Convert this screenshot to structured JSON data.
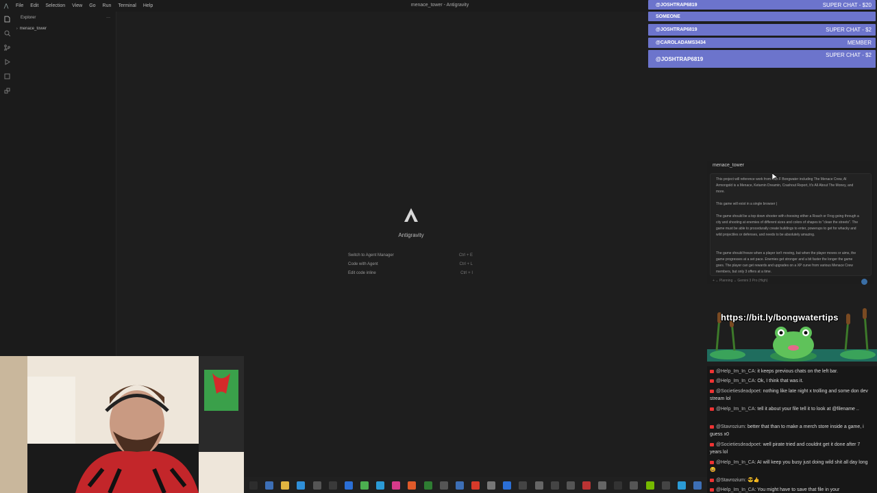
{
  "menubar": {
    "items": [
      "File",
      "Edit",
      "Selection",
      "View",
      "Go",
      "Run",
      "Terminal",
      "Help"
    ],
    "title": "menace_tower - Antigravity"
  },
  "sidebar": {
    "header": "Explorer",
    "more": "···",
    "folder": "menace_tower"
  },
  "welcome": {
    "app_name": "Antigravity",
    "shortcuts": [
      {
        "label": "Switch to Agent Manager",
        "keys": "Ctrl + E"
      },
      {
        "label": "Code with Agent",
        "keys": "Ctrl + L"
      },
      {
        "label": "Edit code inline",
        "keys": "Ctrl + I"
      }
    ]
  },
  "superchats": [
    {
      "user": "@JOSHTRAP6819",
      "label": "SUPER CHAT - $20"
    },
    {
      "user": "SOMEONE",
      "label": ""
    },
    {
      "user": "@JOSHTRAP6819",
      "label": "SUPER CHAT - $2"
    },
    {
      "user": "@CAROLADAMS3434",
      "label": "MEMBER"
    },
    {
      "user": "@JOSHTRAP6819",
      "label": "SUPER CHAT - $2"
    }
  ],
  "agent": {
    "title": "menace_tower",
    "paragraphs": [
      "This project will reference work from Don F Bongwater including The Menace Crew, AI Armongold is a Menace, Ketamin Dreamin, Crashout Report, It's All About The Money, and more.",
      "This game will exist in a single browser |",
      "The game should be a top down shooter with choosing either a Roach or Frog going through a city and shooting at enemies of different sizes and colors of shapes to \"clean the streets\". The game must be able to procedurally create buildings to enter, powerups to get for whacky and wild projectiles or defenses, and needs to be absolutely amazing.",
      "The game should freeze when a player isn't moving, but when the player moves or aims, the game progresses at a set pace. Enemies get stronger and a bit faster the longer the game goes. The player can get rewards and upgrades on a XP curve from various Menace Crew members, but only 3 offers at a time."
    ],
    "footer": "+   ⌄ Planning   ⌄ Gemini 3 Pro (High)"
  },
  "banner": {
    "url": "https://bit.ly/bongwatertips"
  },
  "chat": [
    {
      "user": "@Help_Im_In_CA:",
      "text": "it keeps previous chats on the left bar."
    },
    {
      "user": "@Help_Im_In_CA:",
      "text": "Ok, I think that was it."
    },
    {
      "user": "@Societiesdeadpoet:",
      "text": "nothing like late night x trolling and some don dev stream lol"
    },
    {
      "user": "@Help_Im_In_CA:",
      "text": "tell it about your file tell it to look at @filename .."
    },
    {
      "user": "@Stavrozium:",
      "text": "better that than to make a merch store inside a game, i guess x0"
    },
    {
      "user": "@Societiesdeadpoet:",
      "text": "well pirate tried and couldnt get it done after 7 years lol"
    },
    {
      "user": "@Help_Im_In_CA:",
      "text": "AI will keep you busy just doing wild shit all day long 😆"
    },
    {
      "user": "@Stavrozium:",
      "text": "😎👍"
    },
    {
      "user": "@Help_Im_In_CA:",
      "text": "You might have to save that file in your"
    }
  ],
  "colors": {
    "superchat_bg": "#6c74cc",
    "editor_bg": "#1e1e1e",
    "chat_bg": "#171717"
  }
}
